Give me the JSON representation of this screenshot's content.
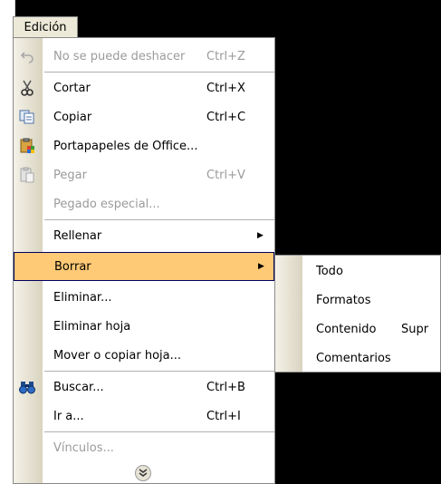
{
  "menu_title": "Edición",
  "items": [
    {
      "label": "No se puede deshacer",
      "shortcut": "Ctrl+Z",
      "icon": "undo-icon",
      "disabled": true
    },
    {
      "label": "Cortar",
      "shortcut": "Ctrl+X",
      "icon": "scissors-icon"
    },
    {
      "label": "Copiar",
      "shortcut": "Ctrl+C",
      "icon": "copy-icon"
    },
    {
      "label": "Portapapeles de Office...",
      "shortcut": "",
      "icon": "office-clipboard-icon"
    },
    {
      "label": "Pegar",
      "shortcut": "Ctrl+V",
      "icon": "paste-icon",
      "disabled": true
    },
    {
      "label": "Pegado especial...",
      "shortcut": "",
      "disabled": true
    },
    {
      "label": "Rellenar",
      "submenu": true
    },
    {
      "label": "Borrar",
      "submenu": true,
      "highlighted": true
    },
    {
      "label": "Eliminar..."
    },
    {
      "label": "Eliminar hoja"
    },
    {
      "label": "Mover o copiar hoja..."
    },
    {
      "label": "Buscar...",
      "shortcut": "Ctrl+B",
      "icon": "binoculars-icon"
    },
    {
      "label": "Ir a...",
      "shortcut": "Ctrl+I"
    },
    {
      "label": "Vínculos...",
      "disabled": true
    }
  ],
  "submenu": [
    {
      "label": "Todo"
    },
    {
      "label": "Formatos"
    },
    {
      "label": "Contenido",
      "shortcut": "Supr"
    },
    {
      "label": "Comentarios"
    }
  ],
  "expand_icon": "chevron-double-down-icon",
  "colors": {
    "highlight": "#ffca75",
    "disabled": "#9b9b9b"
  }
}
